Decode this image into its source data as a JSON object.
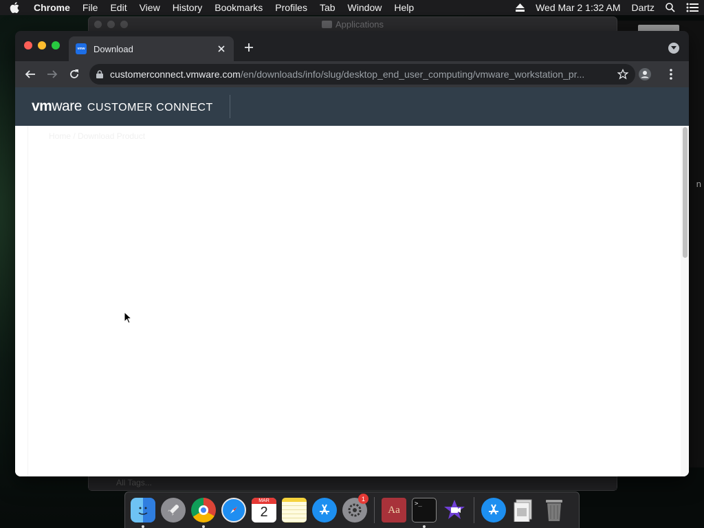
{
  "menubar": {
    "app_name": "Chrome",
    "menus": [
      "File",
      "Edit",
      "View",
      "History",
      "Bookmarks",
      "Profiles",
      "Tab",
      "Window",
      "Help"
    ],
    "datetime": "Wed Mar 2  1:32 AM",
    "user": "Dartz"
  },
  "background_window": {
    "title": "Applications",
    "tags_label": "All Tags..."
  },
  "right_sliver": {
    "letter": "n"
  },
  "browser": {
    "tab": {
      "title": "Download",
      "favicon_text": "vmw"
    },
    "url": {
      "host": "customerconnect.vmware.com",
      "path": "/en/downloads/info/slug/desktop_end_user_computing/vmware_workstation_pr..."
    }
  },
  "page": {
    "logo_bold": "vm",
    "logo_regular": "ware",
    "product_name": "CUSTOMER CONNECT",
    "faint_text": "Home  /  Download Product"
  },
  "dock": {
    "calendar": {
      "month": "MAR",
      "day": "2"
    },
    "settings_badge": "1",
    "dictionary_label": "Aa",
    "terminal_prompt": ">_"
  }
}
